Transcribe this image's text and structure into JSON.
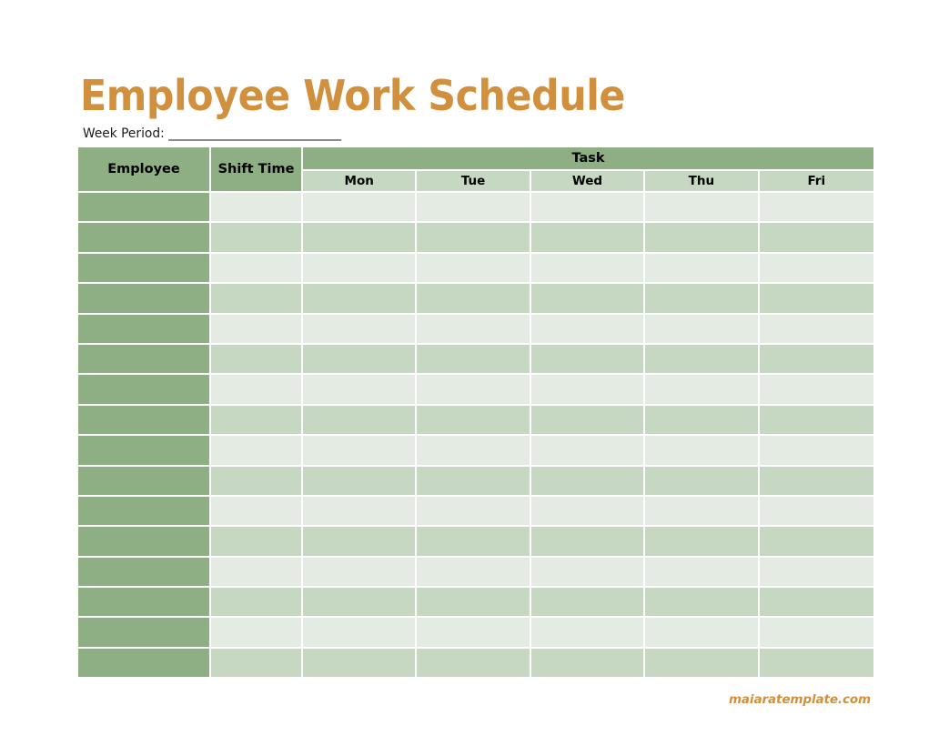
{
  "document": {
    "title": "Employee Work Schedule",
    "week_period_label": "Week Period:",
    "week_period_blank": "______________________________",
    "watermark": "maiaratemplate.com"
  },
  "colors": {
    "title_orange": "#d0903e",
    "header_green": "#8eae84",
    "subheader_green": "#c6d8c2",
    "row_light": "#e4ebe2",
    "row_medium": "#c6d8c2",
    "page_background": "#ffffff",
    "grid_line": "#ffffff"
  },
  "table": {
    "headers": {
      "employee": "Employee",
      "shift_time": "Shift Time",
      "task": "Task"
    },
    "days": [
      "Mon",
      "Tue",
      "Wed",
      "Thu",
      "Fri"
    ],
    "day_count": 5,
    "body_row_count": 16,
    "rows": [
      {
        "employee": "",
        "shift_time": "",
        "tasks": [
          "",
          "",
          "",
          "",
          ""
        ]
      },
      {
        "employee": "",
        "shift_time": "",
        "tasks": [
          "",
          "",
          "",
          "",
          ""
        ]
      },
      {
        "employee": "",
        "shift_time": "",
        "tasks": [
          "",
          "",
          "",
          "",
          ""
        ]
      },
      {
        "employee": "",
        "shift_time": "",
        "tasks": [
          "",
          "",
          "",
          "",
          ""
        ]
      },
      {
        "employee": "",
        "shift_time": "",
        "tasks": [
          "",
          "",
          "",
          "",
          ""
        ]
      },
      {
        "employee": "",
        "shift_time": "",
        "tasks": [
          "",
          "",
          "",
          "",
          ""
        ]
      },
      {
        "employee": "",
        "shift_time": "",
        "tasks": [
          "",
          "",
          "",
          "",
          ""
        ]
      },
      {
        "employee": "",
        "shift_time": "",
        "tasks": [
          "",
          "",
          "",
          "",
          ""
        ]
      },
      {
        "employee": "",
        "shift_time": "",
        "tasks": [
          "",
          "",
          "",
          "",
          ""
        ]
      },
      {
        "employee": "",
        "shift_time": "",
        "tasks": [
          "",
          "",
          "",
          "",
          ""
        ]
      },
      {
        "employee": "",
        "shift_time": "",
        "tasks": [
          "",
          "",
          "",
          "",
          ""
        ]
      },
      {
        "employee": "",
        "shift_time": "",
        "tasks": [
          "",
          "",
          "",
          "",
          ""
        ]
      },
      {
        "employee": "",
        "shift_time": "",
        "tasks": [
          "",
          "",
          "",
          "",
          ""
        ]
      },
      {
        "employee": "",
        "shift_time": "",
        "tasks": [
          "",
          "",
          "",
          "",
          ""
        ]
      },
      {
        "employee": "",
        "shift_time": "",
        "tasks": [
          "",
          "",
          "",
          "",
          ""
        ]
      },
      {
        "employee": "",
        "shift_time": "",
        "tasks": [
          "",
          "",
          "",
          "",
          ""
        ]
      }
    ]
  }
}
